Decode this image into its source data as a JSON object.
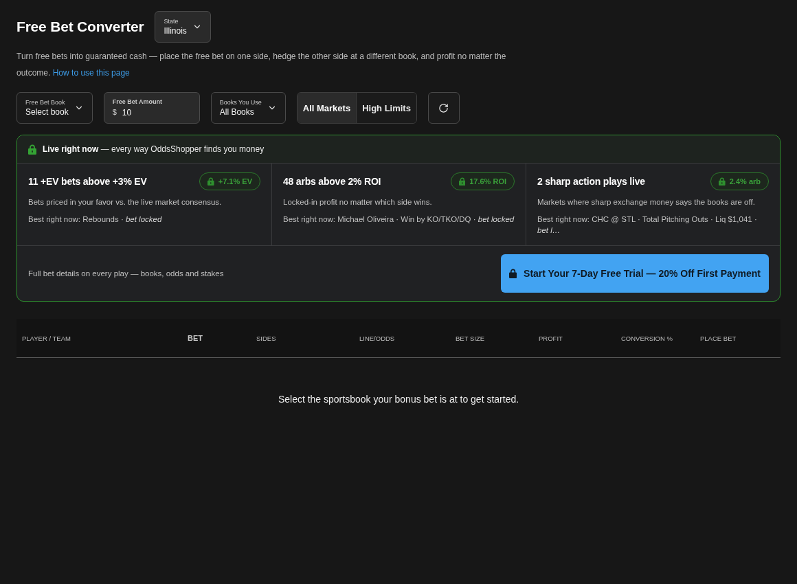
{
  "header": {
    "title": "Free Bet Converter",
    "state_select": {
      "label": "State",
      "value": "Illinois"
    }
  },
  "description": {
    "text": "Turn free bets into guaranteed cash — place the free bet on one side, hedge the other side at a different book, and profit no matter the outcome.",
    "link": "How to use this page"
  },
  "filters": [
    {
      "kind": "select",
      "label": "Free Bet Book",
      "value": "Select book"
    },
    {
      "kind": "amount",
      "label": "Free Bet Amount",
      "prefix": "$",
      "value": "10"
    },
    {
      "kind": "select",
      "label": "Books You Use",
      "value": "All Books"
    }
  ],
  "market_toggle": [
    {
      "label": "All Markets",
      "selected": true
    },
    {
      "label": "High Limits",
      "selected": false
    }
  ],
  "live_panel": {
    "heading": "**Live right now** — every way OddsShopper finds you money",
    "cards": [
      {
        "title": "11 +EV bets above +3% EV",
        "tag": "+7.1% EV",
        "description": "Bets priced in your favor vs. the live market consensus.",
        "best": "Best right now: Rebounds · *bet locked*"
      },
      {
        "title": "48 arbs above 2% ROI",
        "tag": "17.6% ROI",
        "description": "Locked-in profit no matter which side wins.",
        "best": "Best right now: Michael Oliveira · Win by KO/TKO/DQ · *bet locked*"
      },
      {
        "title": "2 sharp action plays live",
        "tag": "2.4% arb",
        "description": "Markets where sharp exchange money says the books are off.",
        "best": "Best right now: CHC @ STL · Total Pitching Outs · Liq $1,041 · *bet l…*"
      }
    ],
    "footer_note": "Full bet details on every play — books, odds and stakes",
    "cta": "Start Your 7-Day Free Trial — 20% Off First Payment"
  },
  "table": {
    "columns": [
      {
        "label": "PLAYER / TEAM",
        "active": false
      },
      {
        "label": "BET",
        "active": true
      },
      {
        "label": "SIDES",
        "active": false
      },
      {
        "label": "LINE/ODDS",
        "active": false
      },
      {
        "label": "BET SIZE",
        "active": false
      },
      {
        "label": "PROFIT",
        "active": false
      },
      {
        "label": "CONVERSION %",
        "active": false
      },
      {
        "label": "PLACE BET",
        "active": false
      }
    ],
    "empty_message": "Select the sportsbook your bonus bet is at to get started."
  }
}
